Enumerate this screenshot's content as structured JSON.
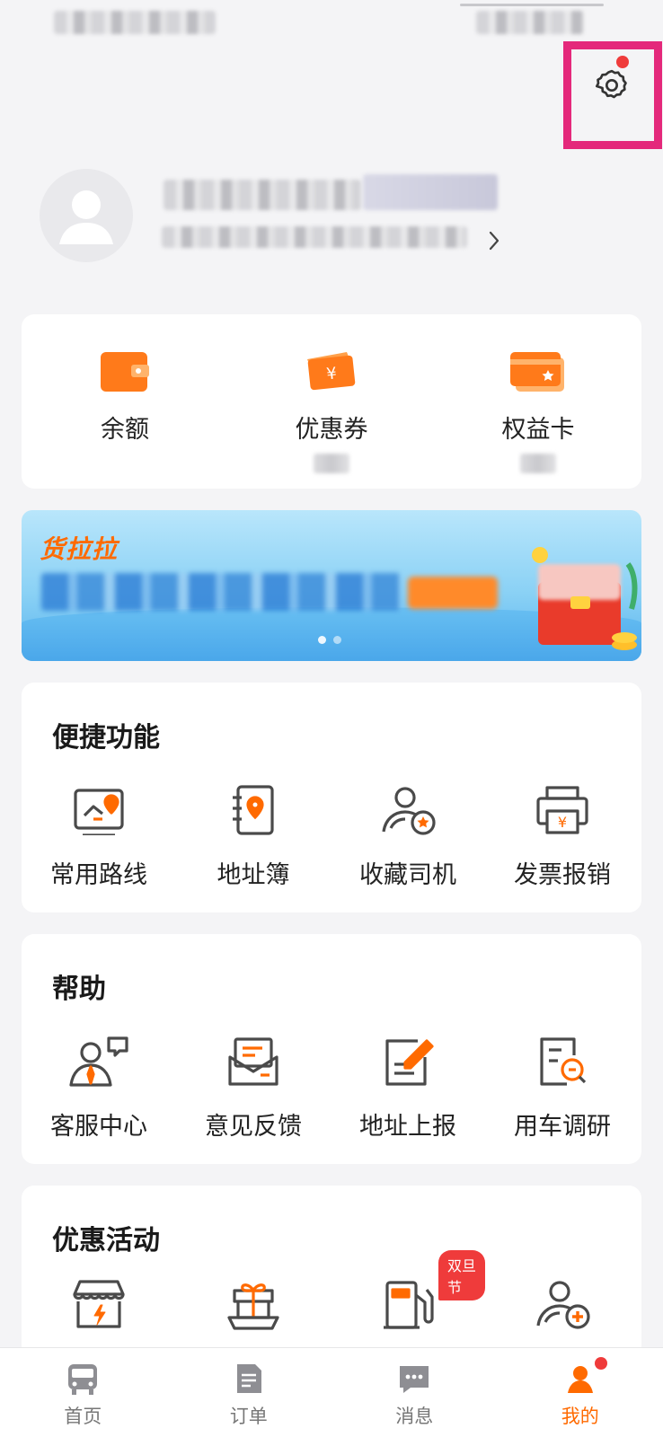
{
  "wallet": {
    "items": [
      {
        "label": "余额"
      },
      {
        "label": "优惠券"
      },
      {
        "label": "权益卡"
      }
    ]
  },
  "banner": {
    "brand": "货拉拉"
  },
  "sections": {
    "quick": {
      "title": "便捷功能",
      "items": [
        {
          "label": "常用路线",
          "icon": "map-route-icon"
        },
        {
          "label": "地址簿",
          "icon": "address-book-icon"
        },
        {
          "label": "收藏司机",
          "icon": "favorite-driver-icon"
        },
        {
          "label": "发票报销",
          "icon": "invoice-printer-icon"
        }
      ]
    },
    "help": {
      "title": "帮助",
      "items": [
        {
          "label": "客服中心",
          "icon": "customer-service-icon"
        },
        {
          "label": "意见反馈",
          "icon": "feedback-mail-icon"
        },
        {
          "label": "地址上报",
          "icon": "address-report-icon"
        },
        {
          "label": "用车调研",
          "icon": "survey-search-icon"
        }
      ]
    },
    "promo": {
      "title": "优惠活动",
      "items": [
        {
          "icon": "store-icon"
        },
        {
          "icon": "gift-icon"
        },
        {
          "icon": "fuel-pump-icon",
          "badge": "双旦节"
        },
        {
          "icon": "driver-plus-icon"
        }
      ]
    }
  },
  "tabbar": {
    "items": [
      {
        "label": "首页",
        "icon": "bus-icon"
      },
      {
        "label": "订单",
        "icon": "order-doc-icon"
      },
      {
        "label": "消息",
        "icon": "chat-bubble-icon"
      },
      {
        "label": "我的",
        "icon": "mine-icon",
        "active": true
      }
    ]
  },
  "colors": {
    "accent": "#ff6a00",
    "badge": "#ef3b3b",
    "highlight": "#e4287b",
    "icon_gray": "#4a4a4a"
  }
}
